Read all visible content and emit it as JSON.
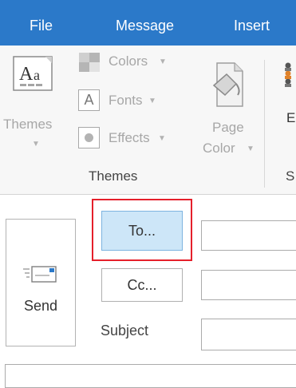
{
  "tabs": [
    {
      "label": "File"
    },
    {
      "label": "Message"
    },
    {
      "label": "Insert"
    }
  ],
  "ribbon": {
    "themes_button": {
      "label": "Themes",
      "icon": "themes-aa-icon"
    },
    "colors": {
      "label": "Colors",
      "icon": "colors-swatch-icon"
    },
    "fonts": {
      "label": "Fonts",
      "icon": "fonts-a-icon"
    },
    "effects": {
      "label": "Effects",
      "icon": "effects-circle-icon"
    },
    "page_color": {
      "line1": "Page",
      "line2": "Color",
      "icon": "page-color-bucket-icon"
    },
    "next_group_fragment": "E",
    "next_group_label_fragment": "S",
    "group_label": "Themes"
  },
  "compose": {
    "send_label": "Send",
    "to_label": "To...",
    "cc_label": "Cc...",
    "subject_label": "Subject"
  },
  "colors": {
    "tab_bar": "#2b79c9",
    "highlight": "#e51f2b",
    "to_button_bg": "#cde6f8"
  }
}
